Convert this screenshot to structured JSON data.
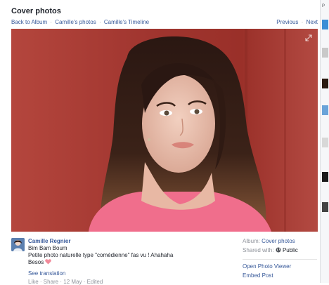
{
  "header": {
    "title": "Cover photos",
    "breadcrumbs": [
      "Back to Album",
      "Camille's photos",
      "Camille's Timeline"
    ],
    "crumb_separator": "·",
    "previous": "Previous",
    "next": "Next"
  },
  "photo": {
    "expand_icon": "expand-icon"
  },
  "post": {
    "author": "Camille Regnier",
    "lines": [
      "Bim Bam Boum",
      "Petite photo naturelle type \"comédienne\" fas vu ! Ahahaha",
      "Besos"
    ],
    "heart_icon": "heart-emoji",
    "see_translation": "See translation",
    "actions": "Like · Share · 12 May · Edited"
  },
  "sidebar": {
    "album_label": "Album:",
    "album_name": "Cover photos",
    "shared_label": "Shared with:",
    "shared_value": "Public",
    "open_viewer": "Open Photo Viewer",
    "embed_post": "Embed Post"
  },
  "right_rail": {
    "label": "P"
  },
  "colors": {
    "link": "#365899",
    "muted": "#90949c",
    "text": "#1d2129",
    "background_wall": "#a43a32",
    "shirt": "#f06e8c"
  }
}
